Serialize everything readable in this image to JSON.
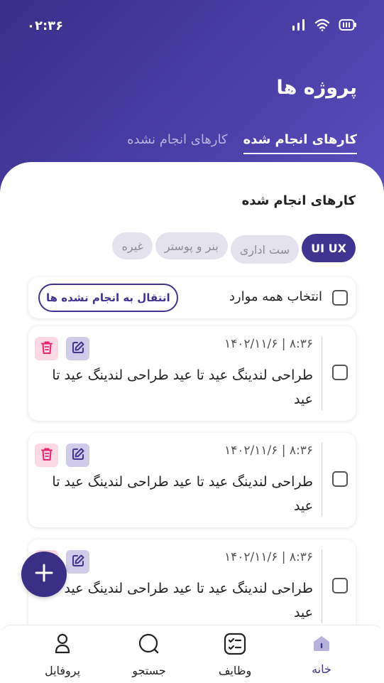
{
  "status_bar": {
    "time": "۰۲:۳۶"
  },
  "header": {
    "title": "پروژه ها",
    "tabs": [
      {
        "label": "کارهای انجام شده",
        "active": true
      },
      {
        "label": "کارهای انجام نشده",
        "active": false
      }
    ]
  },
  "section": {
    "title": "کارهای انجام شده",
    "chips": [
      {
        "label": "UI UX",
        "active": true
      },
      {
        "label": "ست اداری",
        "active": false
      },
      {
        "label": "بنر و پوستر",
        "active": false
      },
      {
        "label": "غیره",
        "active": false
      }
    ]
  },
  "select_all": {
    "label": "انتخاب همه موارد",
    "move_button": "انتقال به انجام نشده ها"
  },
  "tasks": [
    {
      "date": "۸:۳۶ | ۱۴۰۲/۱۱/۶",
      "text": "طراحی لندینگ عید تا عید طراحی لندینگ عید تا عید"
    },
    {
      "date": "۸:۳۶ | ۱۴۰۲/۱۱/۶",
      "text": "طراحی لندینگ عید تا عید طراحی لندینگ عید تا عید"
    },
    {
      "date": "۸:۳۶ | ۱۴۰۲/۱۱/۶",
      "text": "طراحی لندینگ عید تا عید طراحی لندینگ عید تا عید"
    }
  ],
  "bottom_nav": [
    {
      "label": "خانه",
      "icon": "home-icon",
      "active": true
    },
    {
      "label": "وظایف",
      "icon": "checklist-icon",
      "active": false
    },
    {
      "label": "جستجو",
      "icon": "search-icon",
      "active": false
    },
    {
      "label": "پروفایل",
      "icon": "user-icon",
      "active": false
    }
  ],
  "colors": {
    "primary": "#3f348f",
    "header_gradient_start": "#3b2f8a",
    "header_gradient_end": "#5b4fc0",
    "delete": "#e6266e"
  }
}
